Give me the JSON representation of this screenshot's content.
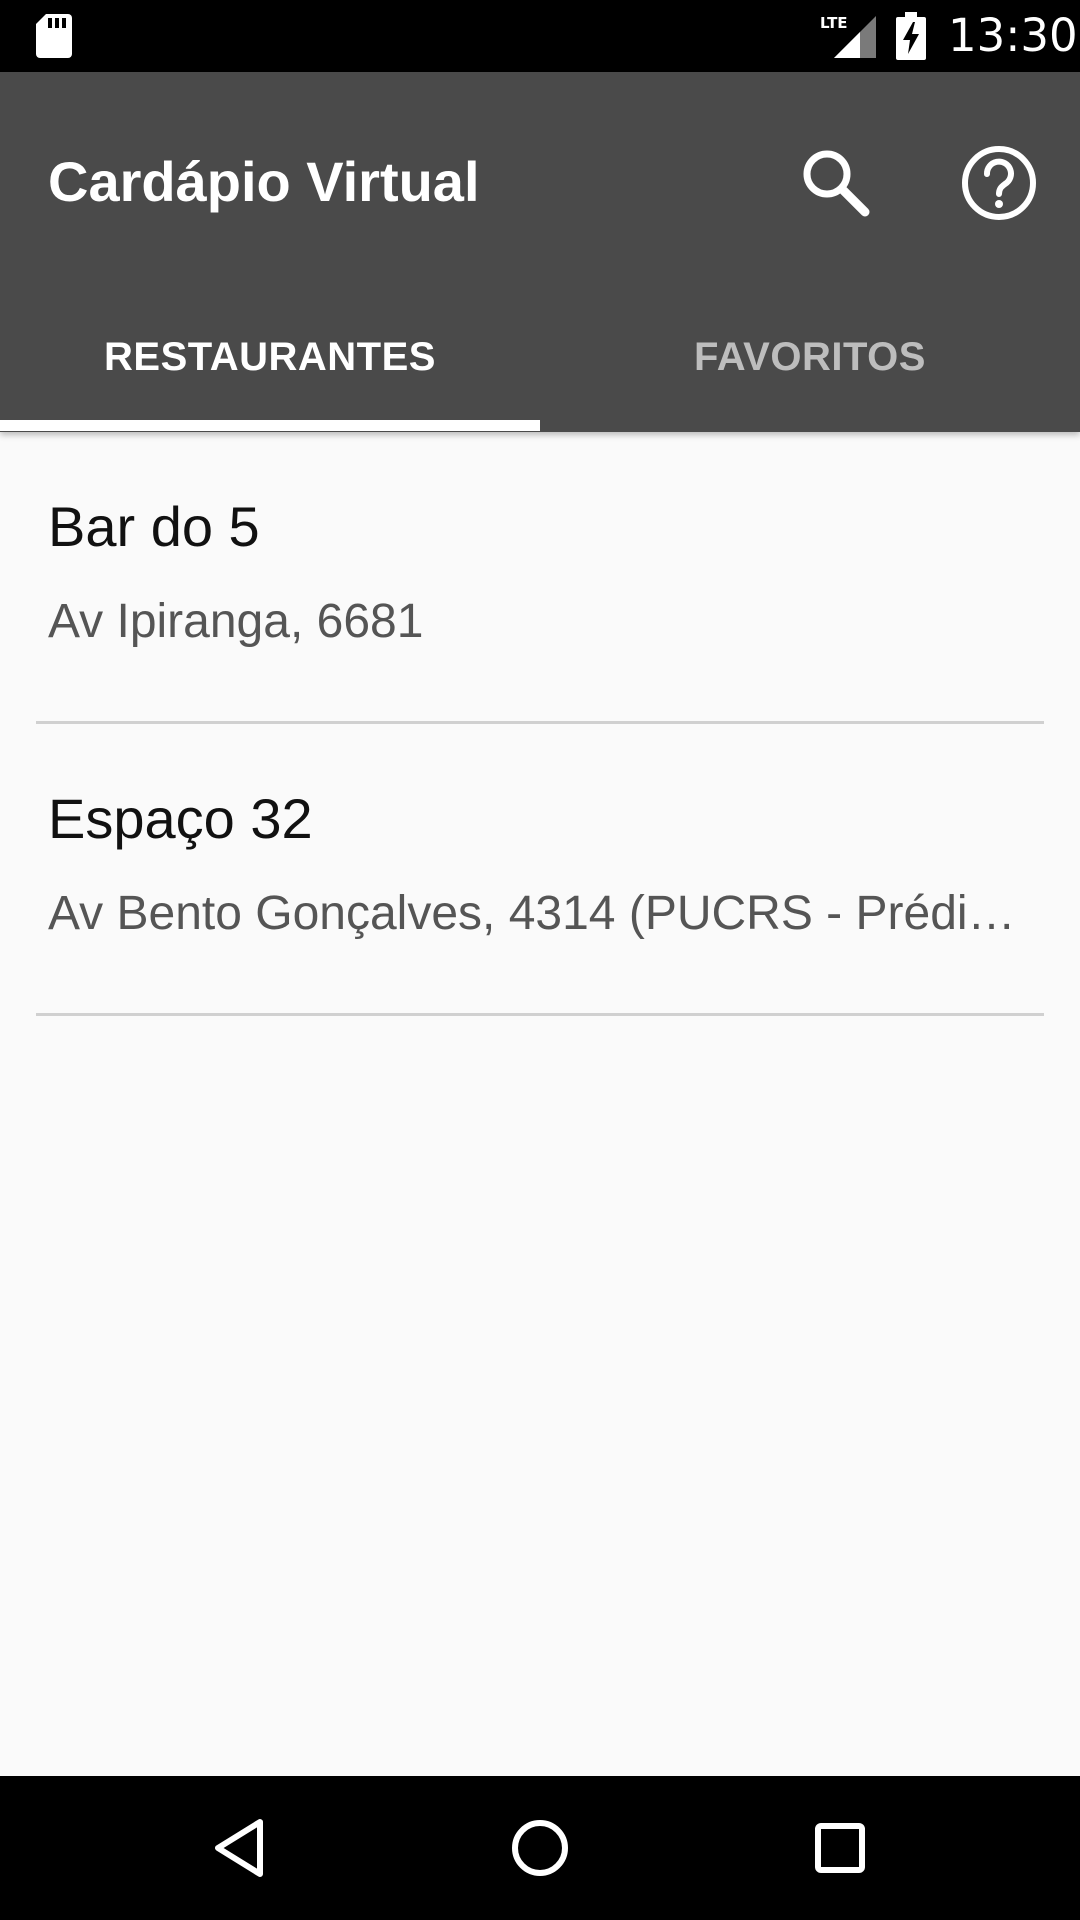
{
  "status_bar": {
    "time": "13:30",
    "network": "LTE",
    "icons": [
      "sd-card-icon",
      "lte-signal-icon",
      "battery-charging-icon"
    ]
  },
  "app_bar": {
    "title": "Cardápio Virtual",
    "actions": [
      "search-icon",
      "help-icon"
    ],
    "background": "#4a4a4a"
  },
  "tabs": [
    {
      "label": "RESTAURANTES",
      "selected": true
    },
    {
      "label": "FAVORITOS",
      "selected": false
    }
  ],
  "restaurants": [
    {
      "name": "Bar do 5",
      "address": "Av Ipiranga, 6681"
    },
    {
      "name": "Espaço 32",
      "address": "Av Bento Gonçalves, 4314 (PUCRS - Prédi…"
    }
  ],
  "nav_bar": {
    "buttons": [
      "back-icon",
      "home-icon",
      "recent-apps-icon"
    ]
  }
}
